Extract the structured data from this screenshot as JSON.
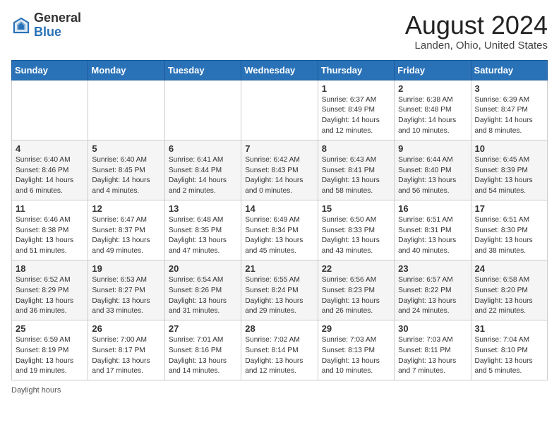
{
  "header": {
    "logo_general": "General",
    "logo_blue": "Blue",
    "month_year": "August 2024",
    "location": "Landen, Ohio, United States"
  },
  "days_of_week": [
    "Sunday",
    "Monday",
    "Tuesday",
    "Wednesday",
    "Thursday",
    "Friday",
    "Saturday"
  ],
  "weeks": [
    [
      {
        "day": "",
        "info": ""
      },
      {
        "day": "",
        "info": ""
      },
      {
        "day": "",
        "info": ""
      },
      {
        "day": "",
        "info": ""
      },
      {
        "day": "1",
        "info": "Sunrise: 6:37 AM\nSunset: 8:49 PM\nDaylight: 14 hours\nand 12 minutes."
      },
      {
        "day": "2",
        "info": "Sunrise: 6:38 AM\nSunset: 8:48 PM\nDaylight: 14 hours\nand 10 minutes."
      },
      {
        "day": "3",
        "info": "Sunrise: 6:39 AM\nSunset: 8:47 PM\nDaylight: 14 hours\nand 8 minutes."
      }
    ],
    [
      {
        "day": "4",
        "info": "Sunrise: 6:40 AM\nSunset: 8:46 PM\nDaylight: 14 hours\nand 6 minutes."
      },
      {
        "day": "5",
        "info": "Sunrise: 6:40 AM\nSunset: 8:45 PM\nDaylight: 14 hours\nand 4 minutes."
      },
      {
        "day": "6",
        "info": "Sunrise: 6:41 AM\nSunset: 8:44 PM\nDaylight: 14 hours\nand 2 minutes."
      },
      {
        "day": "7",
        "info": "Sunrise: 6:42 AM\nSunset: 8:43 PM\nDaylight: 14 hours\nand 0 minutes."
      },
      {
        "day": "8",
        "info": "Sunrise: 6:43 AM\nSunset: 8:41 PM\nDaylight: 13 hours\nand 58 minutes."
      },
      {
        "day": "9",
        "info": "Sunrise: 6:44 AM\nSunset: 8:40 PM\nDaylight: 13 hours\nand 56 minutes."
      },
      {
        "day": "10",
        "info": "Sunrise: 6:45 AM\nSunset: 8:39 PM\nDaylight: 13 hours\nand 54 minutes."
      }
    ],
    [
      {
        "day": "11",
        "info": "Sunrise: 6:46 AM\nSunset: 8:38 PM\nDaylight: 13 hours\nand 51 minutes."
      },
      {
        "day": "12",
        "info": "Sunrise: 6:47 AM\nSunset: 8:37 PM\nDaylight: 13 hours\nand 49 minutes."
      },
      {
        "day": "13",
        "info": "Sunrise: 6:48 AM\nSunset: 8:35 PM\nDaylight: 13 hours\nand 47 minutes."
      },
      {
        "day": "14",
        "info": "Sunrise: 6:49 AM\nSunset: 8:34 PM\nDaylight: 13 hours\nand 45 minutes."
      },
      {
        "day": "15",
        "info": "Sunrise: 6:50 AM\nSunset: 8:33 PM\nDaylight: 13 hours\nand 43 minutes."
      },
      {
        "day": "16",
        "info": "Sunrise: 6:51 AM\nSunset: 8:31 PM\nDaylight: 13 hours\nand 40 minutes."
      },
      {
        "day": "17",
        "info": "Sunrise: 6:51 AM\nSunset: 8:30 PM\nDaylight: 13 hours\nand 38 minutes."
      }
    ],
    [
      {
        "day": "18",
        "info": "Sunrise: 6:52 AM\nSunset: 8:29 PM\nDaylight: 13 hours\nand 36 minutes."
      },
      {
        "day": "19",
        "info": "Sunrise: 6:53 AM\nSunset: 8:27 PM\nDaylight: 13 hours\nand 33 minutes."
      },
      {
        "day": "20",
        "info": "Sunrise: 6:54 AM\nSunset: 8:26 PM\nDaylight: 13 hours\nand 31 minutes."
      },
      {
        "day": "21",
        "info": "Sunrise: 6:55 AM\nSunset: 8:24 PM\nDaylight: 13 hours\nand 29 minutes."
      },
      {
        "day": "22",
        "info": "Sunrise: 6:56 AM\nSunset: 8:23 PM\nDaylight: 13 hours\nand 26 minutes."
      },
      {
        "day": "23",
        "info": "Sunrise: 6:57 AM\nSunset: 8:22 PM\nDaylight: 13 hours\nand 24 minutes."
      },
      {
        "day": "24",
        "info": "Sunrise: 6:58 AM\nSunset: 8:20 PM\nDaylight: 13 hours\nand 22 minutes."
      }
    ],
    [
      {
        "day": "25",
        "info": "Sunrise: 6:59 AM\nSunset: 8:19 PM\nDaylight: 13 hours\nand 19 minutes."
      },
      {
        "day": "26",
        "info": "Sunrise: 7:00 AM\nSunset: 8:17 PM\nDaylight: 13 hours\nand 17 minutes."
      },
      {
        "day": "27",
        "info": "Sunrise: 7:01 AM\nSunset: 8:16 PM\nDaylight: 13 hours\nand 14 minutes."
      },
      {
        "day": "28",
        "info": "Sunrise: 7:02 AM\nSunset: 8:14 PM\nDaylight: 13 hours\nand 12 minutes."
      },
      {
        "day": "29",
        "info": "Sunrise: 7:03 AM\nSunset: 8:13 PM\nDaylight: 13 hours\nand 10 minutes."
      },
      {
        "day": "30",
        "info": "Sunrise: 7:03 AM\nSunset: 8:11 PM\nDaylight: 13 hours\nand 7 minutes."
      },
      {
        "day": "31",
        "info": "Sunrise: 7:04 AM\nSunset: 8:10 PM\nDaylight: 13 hours\nand 5 minutes."
      }
    ]
  ],
  "footer": {
    "note": "Daylight hours"
  }
}
